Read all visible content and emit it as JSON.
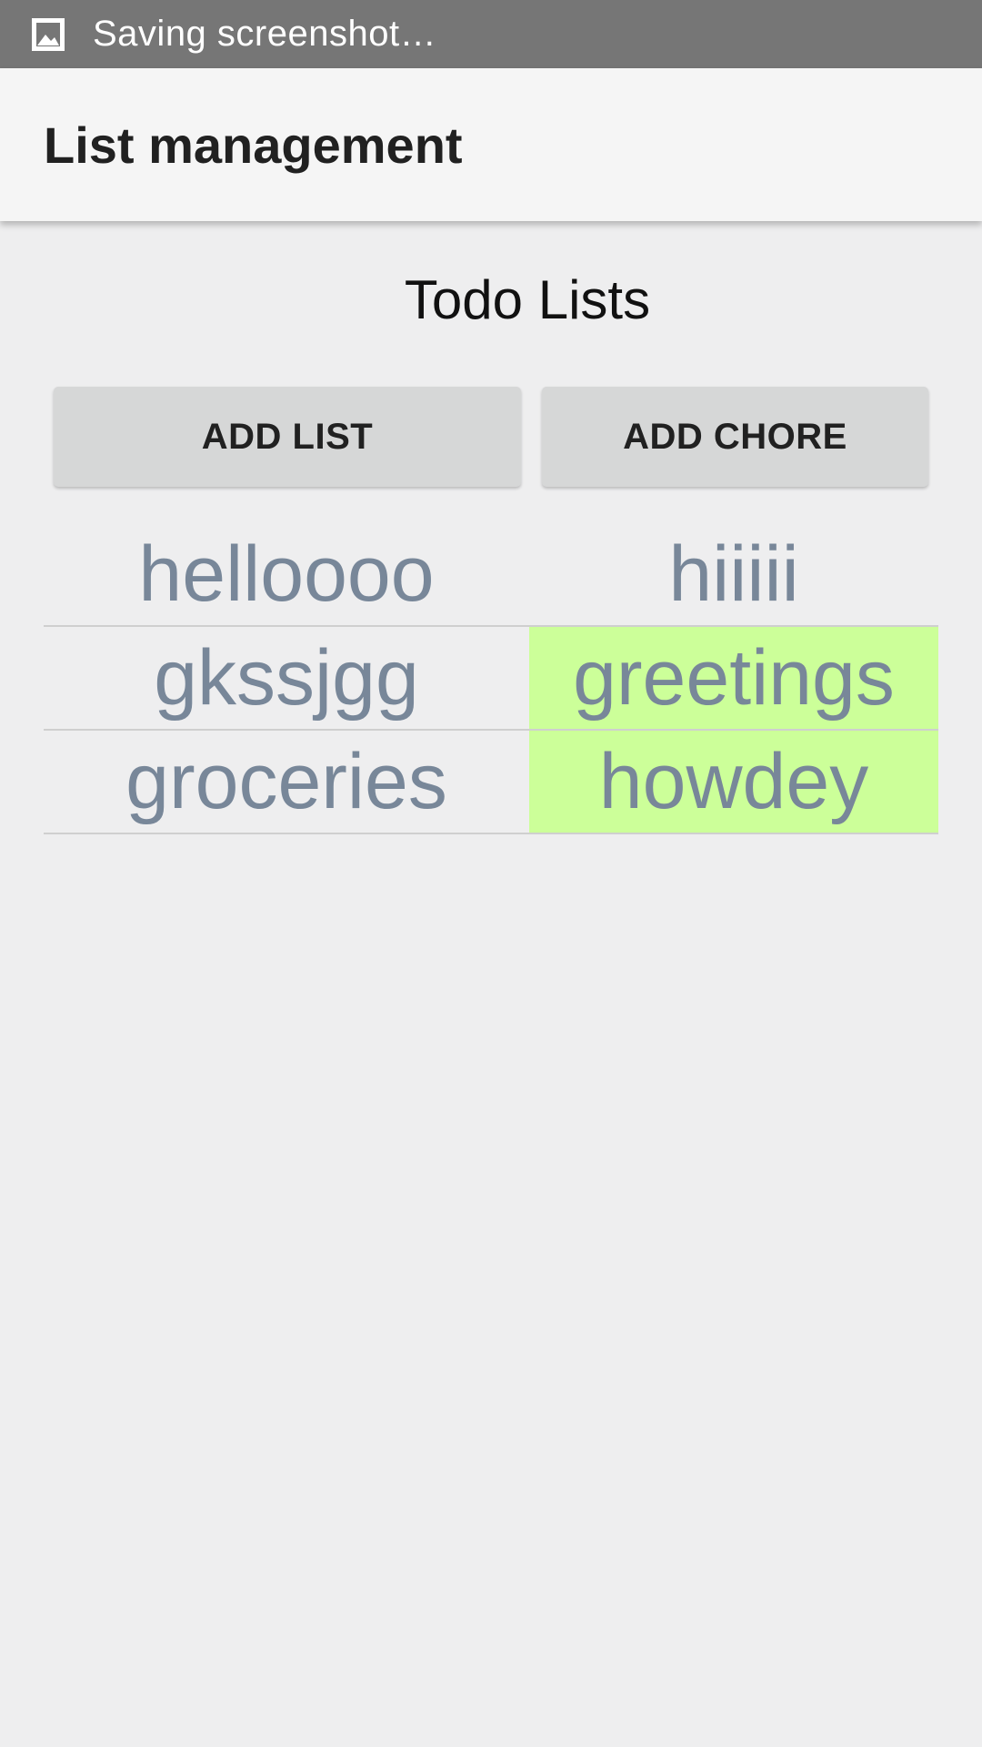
{
  "status_bar": {
    "icon": "image-icon",
    "text": "Saving screenshot…"
  },
  "app_bar": {
    "title": "List management"
  },
  "main": {
    "section_title": "Todo Lists",
    "buttons": {
      "add_list": "ADD LIST",
      "add_chore": "ADD CHORE"
    },
    "rows": [
      {
        "left": "helloooo",
        "right": "hiiiii",
        "right_highlighted": false
      },
      {
        "left": "gkssjgg",
        "right": "greetings",
        "right_highlighted": true
      },
      {
        "left": "groceries",
        "right": "howdey",
        "right_highlighted": true
      }
    ]
  },
  "colors": {
    "status_bar_bg": "#767676",
    "app_bar_bg": "#f5f5f5",
    "page_bg": "#eeeeef",
    "item_text": "#788799",
    "highlight_bg": "#ccff99",
    "button_bg": "#d6d7d7"
  }
}
